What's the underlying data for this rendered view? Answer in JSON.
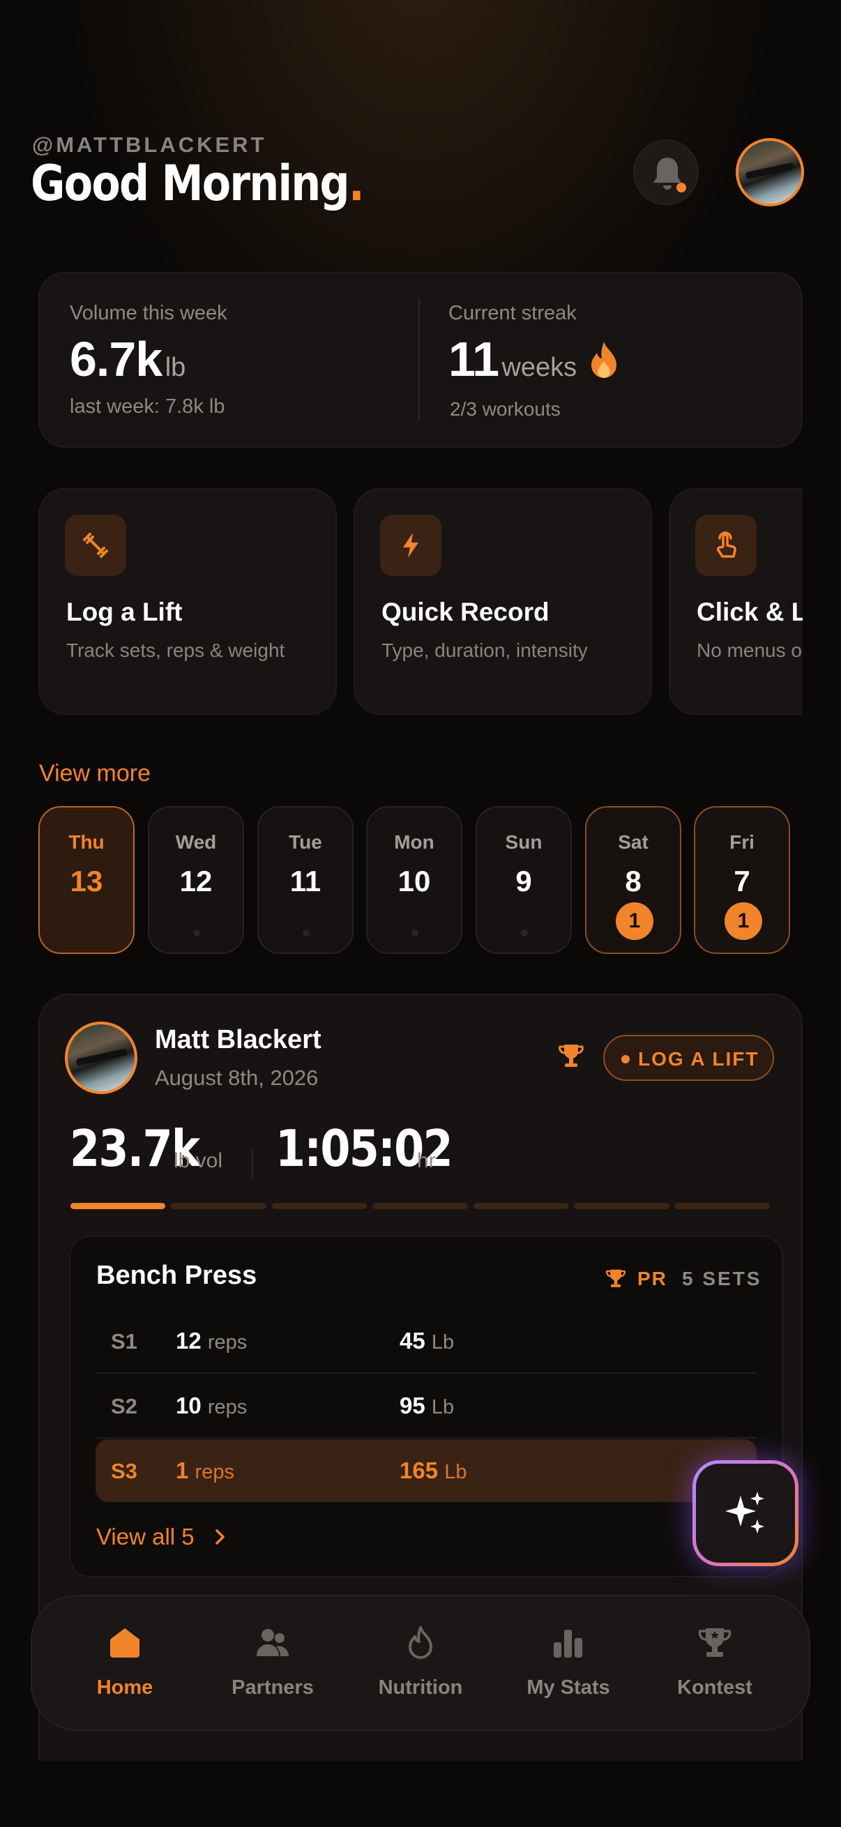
{
  "header": {
    "handle": "@MATTBLACKERT",
    "greeting": "Good Morning",
    "greeting_dot": "."
  },
  "stats": {
    "volume_label": "Volume this week",
    "volume_value": "6.7k",
    "volume_unit": "lb",
    "volume_sub": "last week: 7.8k lb",
    "streak_label": "Current streak",
    "streak_value": "11",
    "streak_unit": "weeks",
    "streak_sub": "2/3 workouts"
  },
  "actions": [
    {
      "title": "Log a Lift",
      "subtitle": "Track sets, reps & weight",
      "icon": "dumbbell-icon"
    },
    {
      "title": "Quick Record",
      "subtitle": "Type, duration, intensity",
      "icon": "bolt-icon"
    },
    {
      "title": "Click & Log",
      "subtitle": "No menus or forms",
      "icon": "tap-icon"
    }
  ],
  "view_more": "View more",
  "days": [
    {
      "name": "Thu",
      "num": "13",
      "state": "active"
    },
    {
      "name": "Wed",
      "num": "12",
      "state": "empty"
    },
    {
      "name": "Tue",
      "num": "11",
      "state": "empty"
    },
    {
      "name": "Mon",
      "num": "10",
      "state": "empty"
    },
    {
      "name": "Sun",
      "num": "9",
      "state": "empty"
    },
    {
      "name": "Sat",
      "num": "8",
      "state": "badged",
      "badge": "1"
    },
    {
      "name": "Fri",
      "num": "7",
      "state": "badged",
      "badge": "1"
    }
  ],
  "workout": {
    "user_name": "Matt Blackert",
    "date": "August 8th, 2026",
    "log_button": "LOG A LIFT",
    "volume_value": "23.7k",
    "volume_unit": "lb vol",
    "duration_value": "1:05:02",
    "duration_unit": "hr",
    "progress_segments_total": 7,
    "progress_segments_done": 1
  },
  "exercise": {
    "name": "Bench Press",
    "pr_label": "PR",
    "sets_label": "5 SETS",
    "sets": [
      {
        "id": "S1",
        "reps": "12",
        "reps_unit": "reps",
        "weight": "45",
        "weight_unit": "Lb",
        "highlight": false
      },
      {
        "id": "S2",
        "reps": "10",
        "reps_unit": "reps",
        "weight": "95",
        "weight_unit": "Lb",
        "highlight": false
      },
      {
        "id": "S3",
        "reps": "1",
        "reps_unit": "reps",
        "weight": "165",
        "weight_unit": "Lb",
        "highlight": true
      }
    ],
    "view_all": "View all 5"
  },
  "nav": [
    {
      "label": "Home",
      "icon": "home-icon",
      "active": true
    },
    {
      "label": "Partners",
      "icon": "partners-icon",
      "active": false
    },
    {
      "label": "Nutrition",
      "icon": "flame-icon",
      "active": false
    },
    {
      "label": "My Stats",
      "icon": "stats-icon",
      "active": false
    },
    {
      "label": "Kontest",
      "icon": "trophy-icon",
      "active": false
    }
  ],
  "colors": {
    "accent": "#f2842c",
    "background": "#0b0908",
    "card": "#171413"
  }
}
